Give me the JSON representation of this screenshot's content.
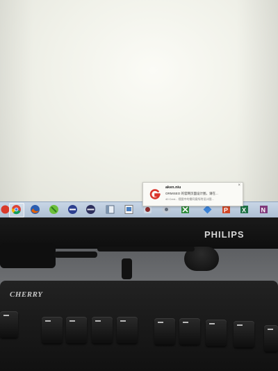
{
  "notification": {
    "title": "aken.niu",
    "line1": "ORMISEO 的官网页面设计图，请在...",
    "line2": "40 Cent... 视图中的需同意所附设计图..."
  },
  "taskbar": {
    "icons": [
      "windows-icon",
      "chrome-icon",
      "firefox-icon",
      "eclipse-icon",
      "tool-icon",
      "app-icon",
      "window-icon",
      "file-icon",
      "photo-icon",
      "network-icon",
      "gear-icon",
      "sheet-icon",
      "app-icon-2",
      "powerpoint-icon",
      "excel-icon",
      "onenote-icon"
    ]
  },
  "monitor": {
    "brand": "PHILIPS"
  },
  "keyboard": {
    "brand": "CHERRY"
  },
  "colors": {
    "taskbar": "#b8c8dc",
    "toast_logo": "#d9342b",
    "bezel": "#141414"
  }
}
